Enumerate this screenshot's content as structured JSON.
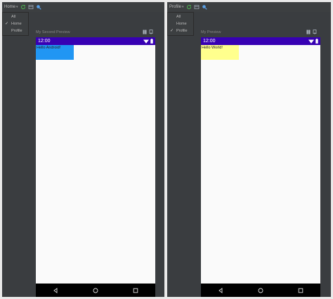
{
  "left_pane": {
    "dropdown_label": "Home",
    "menu_items": [
      {
        "label": "All",
        "checked": false
      },
      {
        "label": "Home",
        "checked": true
      },
      {
        "label": "Profile",
        "checked": false
      }
    ],
    "preview_title": "My Second Preview",
    "status_time": "12:00",
    "greeting": "Hello Android!",
    "greeting_bg": "#2196f3"
  },
  "right_pane": {
    "dropdown_label": "Profile",
    "menu_items": [
      {
        "label": "All",
        "checked": false
      },
      {
        "label": "Home",
        "checked": false
      },
      {
        "label": "Profile",
        "checked": true
      }
    ],
    "preview_title": "My Preview",
    "status_time": "12:00",
    "greeting": "Hello World!",
    "greeting_bg": "#ffff8d"
  },
  "colors": {
    "status_bar": "#3700b3",
    "ide_background": "#3a3d40",
    "refresh_icon": "#4caf50",
    "nav_bar": "#000000"
  },
  "icons": {
    "refresh": "refresh-icon",
    "layout": "layout-icon",
    "inspect": "inspect-icon",
    "pin": "pin-icon",
    "deploy": "deploy-icon",
    "wifi": "wifi-icon",
    "battery": "battery-icon",
    "back": "back-icon",
    "home": "home-icon",
    "recents": "recents-icon"
  }
}
